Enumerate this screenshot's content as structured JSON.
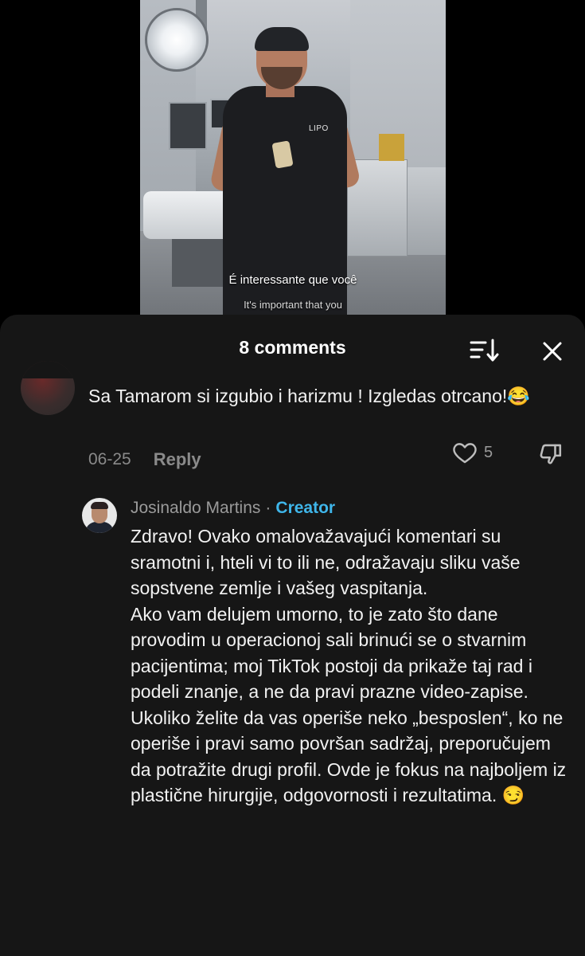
{
  "video": {
    "scrubs_logo": "LIPO",
    "subtitle_main": "É interessante que você",
    "subtitle_translation": "It's important that you"
  },
  "sheet": {
    "comments_count": "8 comments",
    "icons": {
      "sort": "sort-icon",
      "close": "close-icon"
    }
  },
  "comment": {
    "text": "Sa Tamarom si izgubio i harizmu ! Izgledas otrcano!😂",
    "date": "06-25",
    "reply_label": "Reply",
    "likes": "5"
  },
  "reply": {
    "author": "Josinaldo Martins",
    "separator": "·",
    "badge": "Creator",
    "paragraphs": [
      "Zdravo! Ovako omalovažavajući komentari su sramotni i, hteli vi to ili ne, odražavaju sliku vaše sopstvene zemlje i vašeg vaspitanja.",
      "Ako vam delujem umorno, to je zato što dane provodim u operacionoj sali brinući se o stvarnim pacijentima; moj TikTok postoji da prikaže taj rad i podeli znanje, a ne da pravi prazne video-zapise.",
      "Ukoliko želite da vas operiše neko „besposlen“, ko ne operiše i pravi samo površan sadržaj, preporučujem da potražite drugi profil. Ovde je fokus na najboljem iz plastične hirurgije, odgovornosti i rezultatima. 😏"
    ]
  },
  "colors": {
    "sheet_bg": "#161616",
    "creator_badge": "#3fb6ea",
    "muted_text": "#8a8a8a"
  }
}
